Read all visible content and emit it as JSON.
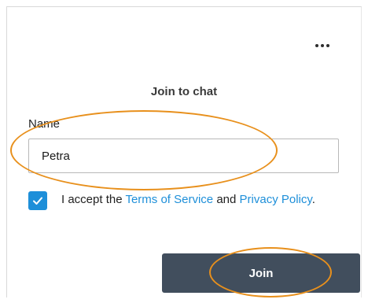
{
  "header": {
    "more_icon": "more-horizontal-icon"
  },
  "form": {
    "title": "Join to chat",
    "name_label": "Name",
    "name_value": "Petra",
    "consent": {
      "checked": true,
      "prefix": "I accept the ",
      "terms_link": "Terms of Service",
      "middle": " and ",
      "privacy_link": "Privacy Policy",
      "suffix": "."
    },
    "join_label": "Join"
  },
  "colors": {
    "accent": "#1e8fd9",
    "button_bg": "#414e5d",
    "annotation": "#e8901c"
  }
}
